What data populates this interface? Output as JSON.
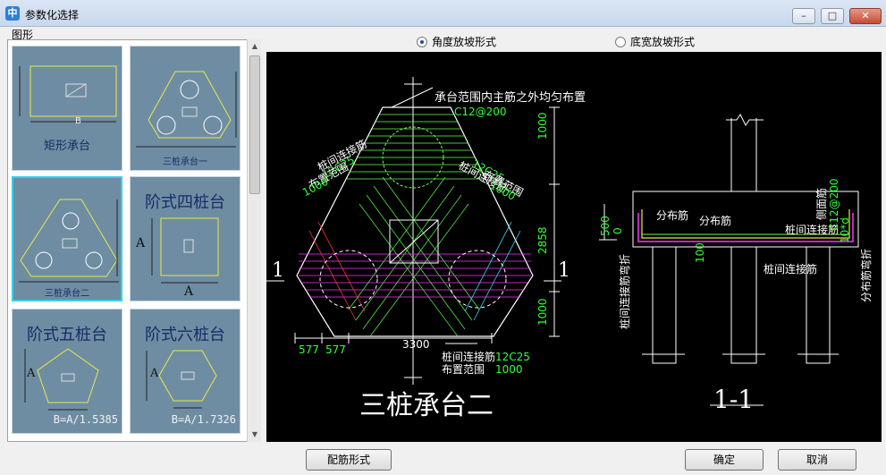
{
  "window": {
    "title": "参数化选择",
    "app_icon_glyph": "中",
    "minimize_glyph": "–",
    "maximize_glyph": "□",
    "close_glyph": "✕"
  },
  "left": {
    "group_label": "图形",
    "thumbnails": [
      {
        "title": "矩形承台",
        "dim_b": "B"
      },
      {
        "title": "三桩承台一"
      },
      {
        "title": "三桩承台二"
      },
      {
        "title": "阶式四桩台",
        "dim_a1": "A",
        "dim_a2": "A"
      },
      {
        "title": "阶式五桩台",
        "dim_a": "A",
        "formula": "B=A/1.5385"
      },
      {
        "title": "阶式六桩台",
        "dim_a": "A",
        "formula": "B=A/1.7326"
      }
    ]
  },
  "options": {
    "radio_angle": "角度放坡形式",
    "radio_width": "底宽放坡形式",
    "selected": "angle"
  },
  "drawing": {
    "title_main": "三桩承台二",
    "title_section": "1-1",
    "section_mark_left": "1",
    "section_mark_right": "1",
    "note_top": "承台范围内主筋之外均匀布置",
    "rebar_top": "C12@200",
    "left_label1": "桩间连接筋",
    "left_label1_val": "12C25",
    "left_label2": "布置范围",
    "left_label2_val": "1000",
    "right_label1": "桩间连接筋",
    "right_label1_val": "12C25",
    "right_label2": "布置范围",
    "right_label2_val": "1000",
    "dim_right_top": "1000",
    "dim_right_mid": "2858",
    "dim_right_bot": "1000",
    "dim_bottom_left1": "577",
    "dim_bottom_left2": "577",
    "dim_bottom_total": "3300",
    "bottom_label1": "桩间连接筋",
    "bottom_label1_val": "12C25",
    "bottom_label2": "布置范围",
    "bottom_label2_val": "1000",
    "sec_dist1": "分布筋",
    "sec_dist2": "分布筋",
    "sec_side": "侧面筋",
    "sec_side_val": "C12@200",
    "sec_pile_link": "桩间连接筋",
    "sec_pile_link2": "桩间连接筋",
    "sec_pile_link_bend": "桩间连接筋弯折",
    "sec_dist_bend": "分布筋弯折",
    "sec_dim_500": "500",
    "sec_dim_0": "0",
    "sec_dim_100": "100",
    "sec_dim_10d": "10*d"
  },
  "buttons": {
    "rebar_form": "配筋形式",
    "ok": "确定",
    "cancel": "取消"
  }
}
